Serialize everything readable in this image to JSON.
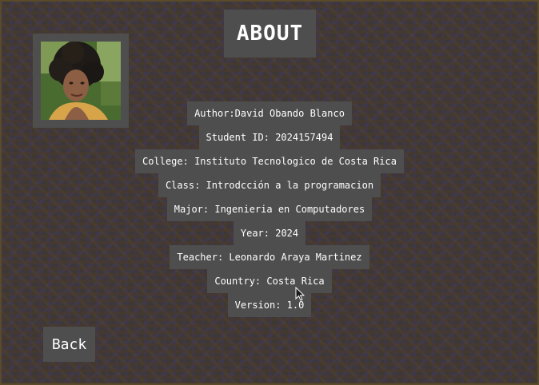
{
  "title": "ABOUT",
  "photo": {
    "description_icon": "portrait-photo"
  },
  "info": {
    "author": "Author:David Obando Blanco",
    "student_id": "Student ID: 2024157494",
    "college": "College: Instituto Tecnologico de Costa Rica",
    "class": "Class: Introdcción a la programacion",
    "major": "Major: Ingenieria en Computadores",
    "year": "Year: 2024",
    "teacher": "Teacher: Leonardo Araya Martinez",
    "country": "Country: Costa Rica",
    "version": "Version: 1.0"
  },
  "back_button": {
    "label": "Back"
  },
  "colors": {
    "panel": "#4e4e4e",
    "text": "#ffffff"
  }
}
